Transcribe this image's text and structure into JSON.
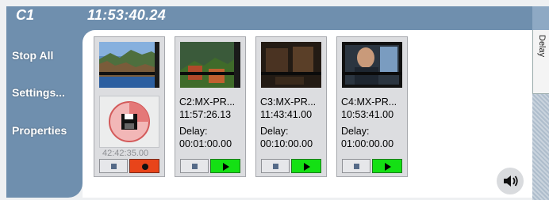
{
  "window": {
    "title": "C1",
    "clock": "11:53:40.24"
  },
  "sidebar": {
    "stop_all": "Stop All",
    "settings": "Settings...",
    "properties": "Properties"
  },
  "side_tab": {
    "label": "Delay"
  },
  "recorder": {
    "elapsed": "42:42:35.00",
    "disk_icon": "floppy-disk-icon",
    "stop_icon": "stop-icon",
    "record_icon": "record-icon",
    "record_color": "#e8441a"
  },
  "channels": [
    {
      "name": "C2:MX-PR...",
      "time": "11:57:26.13",
      "delay_label": "Delay:",
      "delay": "00:01:00.00",
      "play_color": "#14e014"
    },
    {
      "name": "C3:MX-PR...",
      "time": "11:43:41.00",
      "delay_label": "Delay:",
      "delay": "00:10:00.00",
      "play_color": "#14e014"
    },
    {
      "name": "C4:MX-PR...",
      "time": "10:53:41.00",
      "delay_label": "Delay:",
      "delay": "01:00:00.00",
      "play_color": "#14e014"
    }
  ],
  "audio": {
    "icon": "speaker-icon"
  },
  "colors": {
    "chrome": "#6f8fae",
    "card": "#dcdde0",
    "accent_green": "#14e014",
    "accent_red": "#e8441a"
  }
}
